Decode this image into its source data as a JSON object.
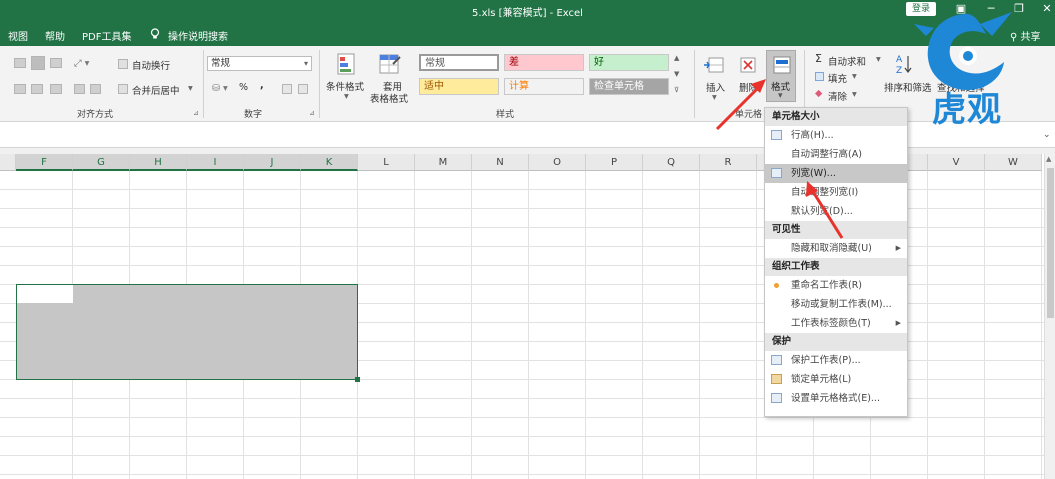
{
  "window": {
    "title": "5.xls  [兼容模式]  -  Excel",
    "login_label": "登录",
    "share_label": "共享",
    "controls": {
      "ribbon_display": "▣",
      "minimize": "─",
      "restore": "❐",
      "close": "✕"
    }
  },
  "menu": {
    "items": [
      "视图",
      "帮助",
      "PDF工具集",
      "操作说明搜索"
    ],
    "search_icon": "lightbulb-icon"
  },
  "ribbon": {
    "alignment": {
      "label": "对齐方式",
      "wrap_text": "自动换行",
      "merge_center": "合并后居中"
    },
    "number": {
      "label": "数字",
      "format_value": "常规",
      "percent": "%",
      "comma": ","
    },
    "styles": {
      "label": "样式",
      "conditional_format": "条件格式",
      "format_table_line1": "套用",
      "format_table_line2": "表格格式",
      "cells": [
        {
          "text": "常规",
          "bg": "#ffffff",
          "fg": "#555555"
        },
        {
          "text": "差",
          "bg": "#ffc7ce",
          "fg": "#9c0006"
        },
        {
          "text": "好",
          "bg": "#c6efce",
          "fg": "#006100"
        },
        {
          "text": "适中",
          "bg": "#ffeb9c",
          "fg": "#9c5700"
        },
        {
          "text": "计算",
          "bg": "#f2f2f2",
          "fg": "#fa7d00"
        },
        {
          "text": "检查单元格",
          "bg": "#a5a5a5",
          "fg": "#ffffff"
        }
      ]
    },
    "cells": {
      "label": "单元格",
      "insert": "插入",
      "delete": "删除",
      "format": "格式"
    },
    "editing": {
      "autosum": "自动求和",
      "fill": "填充",
      "clear": "清除",
      "sort_filter": "排序和筛选",
      "find_select": "查找和选择"
    }
  },
  "grid": {
    "columns": [
      "F",
      "G",
      "H",
      "I",
      "J",
      "K",
      "L",
      "M",
      "N",
      "O",
      "P",
      "Q",
      "R",
      "S",
      "T",
      "U",
      "V",
      "W"
    ],
    "active_columns": [
      "F",
      "G",
      "H",
      "I",
      "J",
      "K"
    ]
  },
  "format_menu": {
    "sections": [
      {
        "header": "单元格大小",
        "items": [
          {
            "label": "行高(H)...",
            "icon": "row-height-icon"
          },
          {
            "label": "自动调整行高(A)",
            "icon": ""
          },
          {
            "label": "列宽(W)...",
            "icon": "column-width-icon",
            "highlighted": true
          },
          {
            "label": "自动调整列宽(I)",
            "icon": ""
          },
          {
            "label": "默认列宽(D)...",
            "icon": ""
          }
        ]
      },
      {
        "header": "可见性",
        "items": [
          {
            "label": "隐藏和取消隐藏(U)",
            "icon": "",
            "submenu": true
          }
        ]
      },
      {
        "header": "组织工作表",
        "items": [
          {
            "label": "重命名工作表(R)",
            "icon": "bullet-icon"
          },
          {
            "label": "移动或复制工作表(M)...",
            "icon": ""
          },
          {
            "label": "工作表标签颜色(T)",
            "icon": "",
            "submenu": true
          }
        ]
      },
      {
        "header": "保护",
        "items": [
          {
            "label": "保护工作表(P)...",
            "icon": "protect-sheet-icon"
          },
          {
            "label": "锁定单元格(L)",
            "icon": "lock-cell-icon"
          },
          {
            "label": "设置单元格格式(E)...",
            "icon": "format-cells-icon"
          }
        ]
      }
    ]
  },
  "watermark": {
    "text": "虎观",
    "color": "#1e87d6"
  },
  "colors": {
    "excel_green": "#217346",
    "arrow_red": "#e8322b"
  }
}
